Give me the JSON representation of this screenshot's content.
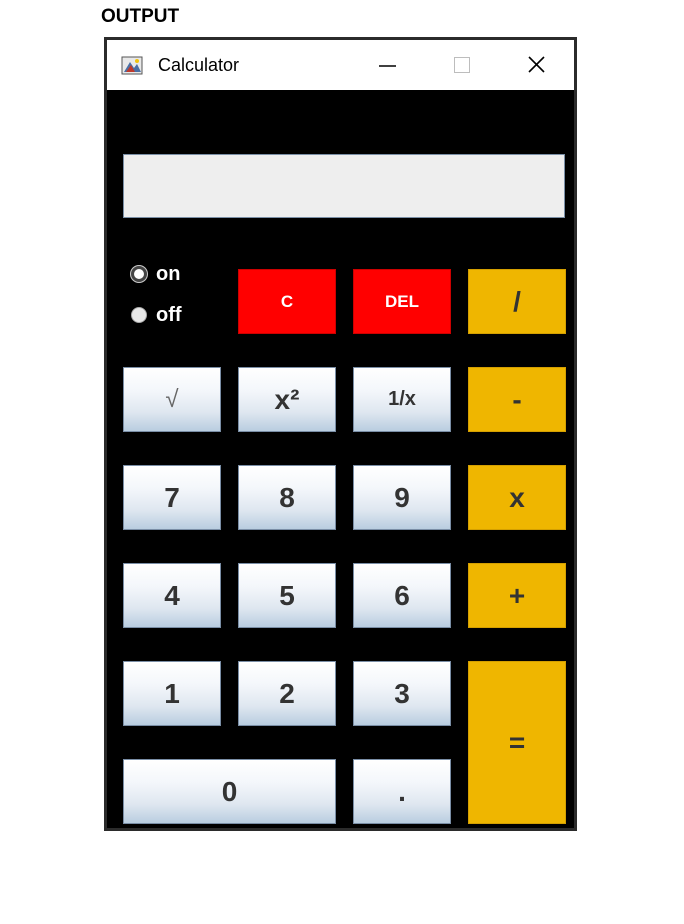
{
  "heading": "OUTPUT",
  "window": {
    "title": "Calculator",
    "icon": "java-app-icon",
    "controls": [
      "minimize-icon",
      "maximize-icon",
      "close-icon"
    ]
  },
  "display": {
    "value": ""
  },
  "power": {
    "on_label": "on",
    "off_label": "off",
    "selected": "on"
  },
  "buttons": {
    "clear": "C",
    "delete": "DEL",
    "divide": "/",
    "sqrt": "√",
    "square": "x²",
    "reciprocal": "1/x",
    "subtract": "-",
    "seven": "7",
    "eight": "8",
    "nine": "9",
    "multiply": "x",
    "four": "4",
    "five": "5",
    "six": "6",
    "add": "+",
    "one": "1",
    "two": "2",
    "three": "3",
    "equals": "=",
    "zero": "0",
    "dot": "."
  },
  "colors": {
    "clear_buttons": "#ff0000",
    "operator_buttons": "#efb600",
    "background": "#000000",
    "display": "#eeeeee"
  }
}
